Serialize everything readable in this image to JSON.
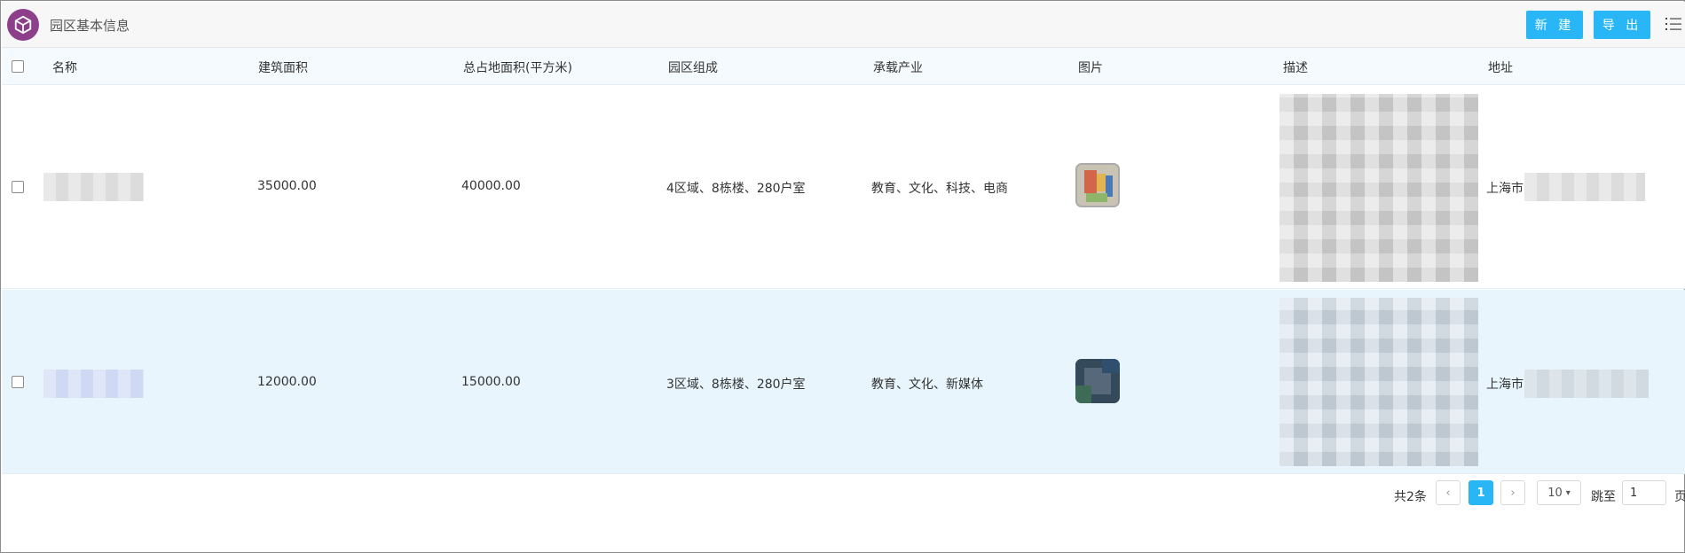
{
  "header": {
    "title": "园区基本信息",
    "new_label": "新 建",
    "export_label": "导 出",
    "logo_icon": "cube-icon",
    "menu_icon": "list-icon"
  },
  "table": {
    "columns": [
      "名称",
      "建筑面积",
      "总占地面积(平方米)",
      "园区组成",
      "承载产业",
      "图片",
      "描述",
      "地址"
    ],
    "rows": [
      {
        "name": "",
        "building_area": "35000.00",
        "total_area": "40000.00",
        "composition": "4区域、8栋楼、280户室",
        "industry": "教育、文化、科技、电商",
        "address_prefix": "上海市"
      },
      {
        "name": "",
        "building_area": "12000.00",
        "total_area": "15000.00",
        "composition": "3区域、8栋楼、280户室",
        "industry": "教育、文化、新媒体",
        "address_prefix": "上海市"
      }
    ]
  },
  "pagination": {
    "total": "共2条",
    "current_page": "1",
    "page_size": "10",
    "jump_label": "跳至",
    "jump_value": "1",
    "page_suffix": "页"
  },
  "colors": {
    "accent": "#29b6f6",
    "logo": "#8e3f8a",
    "selected_row": "#e8f5fd"
  }
}
